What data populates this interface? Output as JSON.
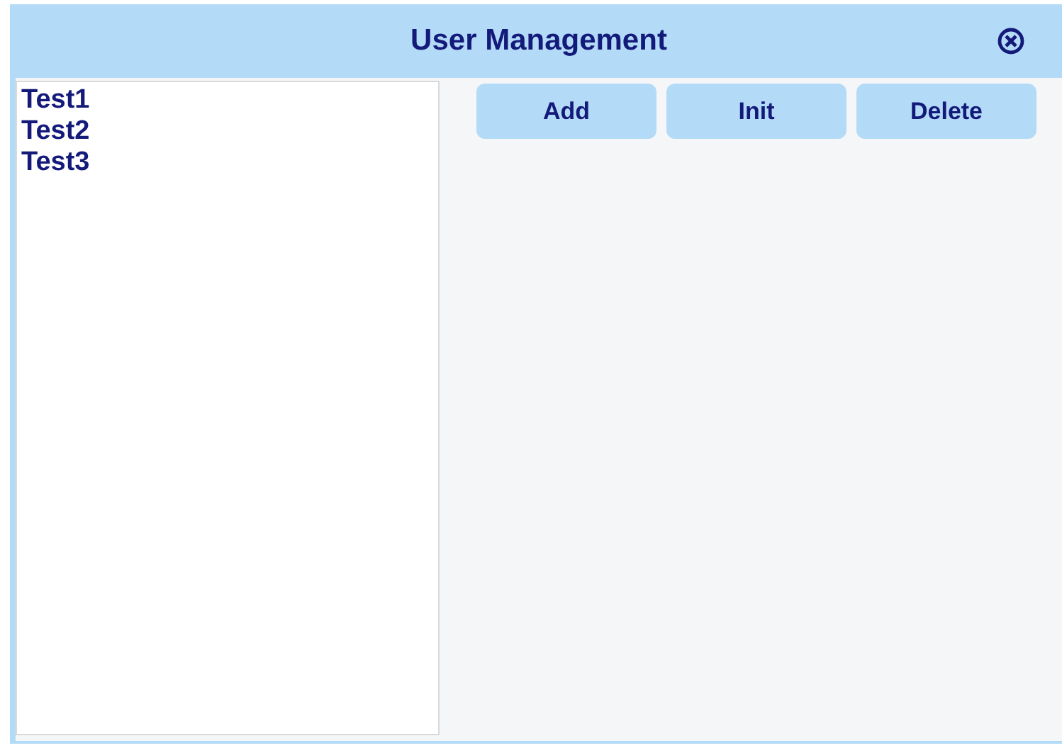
{
  "window": {
    "title": "User Management"
  },
  "users": [
    "Test1",
    "Test2",
    "Test3"
  ],
  "buttons": [
    "Add",
    "Init",
    "Delete"
  ]
}
